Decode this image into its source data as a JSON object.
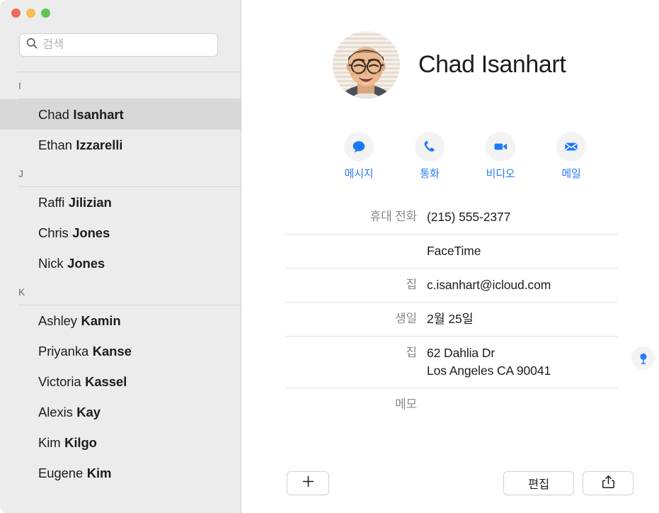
{
  "window": {
    "traffic_lights": [
      {
        "name": "close",
        "color": "#ed6a5e"
      },
      {
        "name": "minimize",
        "color": "#f5bf4f"
      },
      {
        "name": "zoom",
        "color": "#61c454"
      }
    ]
  },
  "sidebar": {
    "search": {
      "placeholder": "검색",
      "value": "",
      "icon": "search-icon"
    },
    "sections": [
      {
        "letter": "I",
        "contacts": [
          {
            "first": "Chad",
            "last": "Isanhart",
            "selected": true
          },
          {
            "first": "Ethan",
            "last": "Izzarelli",
            "selected": false
          }
        ]
      },
      {
        "letter": "J",
        "contacts": [
          {
            "first": "Raffi",
            "last": "Jilizian",
            "selected": false
          },
          {
            "first": "Chris",
            "last": "Jones",
            "selected": false
          },
          {
            "first": "Nick",
            "last": "Jones",
            "selected": false
          }
        ]
      },
      {
        "letter": "K",
        "contacts": [
          {
            "first": "Ashley",
            "last": "Kamin",
            "selected": false
          },
          {
            "first": "Priyanka",
            "last": "Kanse",
            "selected": false
          },
          {
            "first": "Victoria",
            "last": "Kassel",
            "selected": false
          },
          {
            "first": "Alexis",
            "last": "Kay",
            "selected": false
          },
          {
            "first": "Kim",
            "last": "Kilgo",
            "selected": false
          },
          {
            "first": "Eugene",
            "last": "Kim",
            "selected": false
          }
        ]
      }
    ]
  },
  "detail": {
    "name": "Chad Isanhart",
    "avatar": {
      "icon": "contact-photo",
      "alt": "Chad Isanhart"
    },
    "actions": [
      {
        "label": "메시지",
        "icon": "message-bubble-icon",
        "color": "#1a7bfa"
      },
      {
        "label": "통화",
        "icon": "phone-icon",
        "color": "#1a7bfa"
      },
      {
        "label": "비디오",
        "icon": "video-camera-icon",
        "color": "#1a7bfa"
      },
      {
        "label": "메일",
        "icon": "envelope-icon",
        "color": "#1a7bfa"
      }
    ],
    "fields": [
      {
        "label": "휴대 전화",
        "value": "(215) 555-2377",
        "lines": [
          "(215) 555-2377"
        ],
        "pin": false
      },
      {
        "label": "",
        "value": "FaceTime",
        "lines": [
          "FaceTime"
        ],
        "pin": false
      },
      {
        "label": "집",
        "value": "c.isanhart@icloud.com",
        "lines": [
          "c.isanhart@icloud.com"
        ],
        "pin": false
      },
      {
        "label": "생일",
        "value": "2월 25일",
        "lines": [
          "2월 25일"
        ],
        "pin": false
      },
      {
        "label": "집",
        "value": "62 Dahlia Dr Los Angeles CA 90041",
        "lines": [
          "62 Dahlia Dr",
          "Los Angeles CA 90041"
        ],
        "pin": true
      }
    ],
    "notes": {
      "label": "메모",
      "value": ""
    }
  },
  "toolbar": {
    "add_label": "+",
    "add_icon": "plus-icon",
    "edit_label": "편집",
    "share_icon": "share-icon"
  },
  "colors": {
    "accent": "#1a7bfa",
    "sidebar_bg": "#ececec",
    "selected_row": "#d8d8d8",
    "label_gray": "#8a8a8a"
  }
}
